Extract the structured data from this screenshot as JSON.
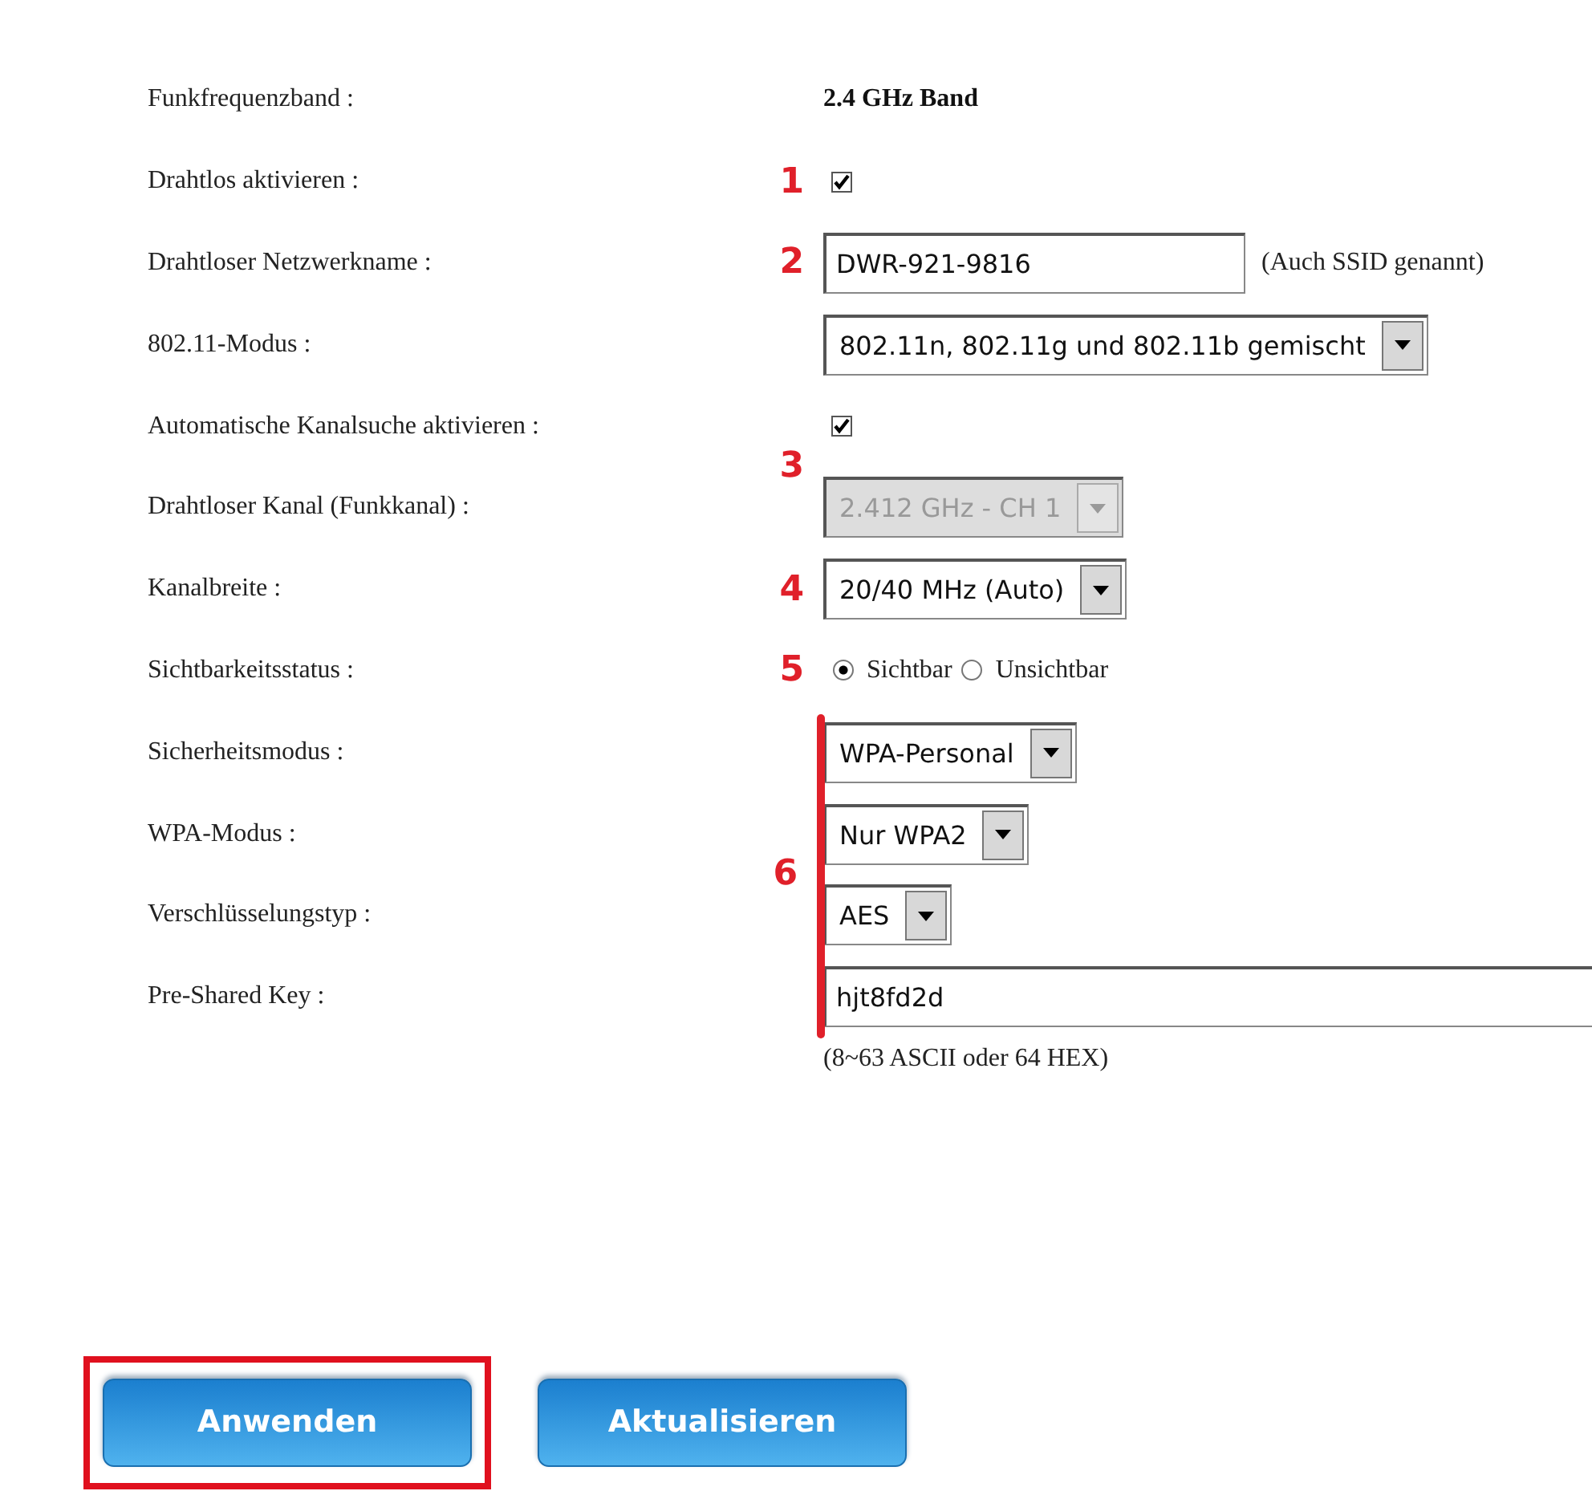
{
  "groups": [
    {
      "fields": [
        {
          "kind": "text",
          "label": "Funkfrequenzband :",
          "value": "2.4 GHz Band"
        }
      ]
    },
    {
      "marker": "1",
      "fields": [
        {
          "kind": "checkbox",
          "label": "Drahtlos aktivieren :",
          "checked": true
        }
      ]
    },
    {
      "marker": "2",
      "fields": [
        {
          "kind": "input",
          "label": "Drahtloser Netzwerkname :",
          "value": "DWR-921-9816",
          "note": "(Auch SSID genannt)"
        }
      ]
    },
    {
      "fields": [
        {
          "kind": "select",
          "label": "802.11-Modus :",
          "value": "802.11n, 802.11g und 802.11b gemischt",
          "disabled": false
        }
      ]
    },
    {
      "marker": "3",
      "fields": [
        {
          "kind": "checkbox",
          "label": "Automatische Kanalsuche aktivieren :",
          "checked": true
        },
        {
          "kind": "select",
          "label": "Drahtloser Kanal (Funkkanal) :",
          "value": "2.412 GHz - CH 1",
          "disabled": true
        }
      ]
    },
    {
      "marker": "4",
      "fields": [
        {
          "kind": "select",
          "label": "Kanalbreite :",
          "value": "20/40 MHz (Auto)",
          "disabled": false
        }
      ]
    },
    {
      "marker": "5",
      "fields": [
        {
          "kind": "radio",
          "label": "Sichtbarkeitsstatus :",
          "options": [
            {
              "label": "Sichtbar",
              "selected": true
            },
            {
              "label": "Unsichtbar",
              "selected": false
            }
          ]
        }
      ]
    },
    {
      "marker": "6",
      "bracket": true,
      "fields": [
        {
          "kind": "select",
          "label": "Sicherheitsmodus :",
          "value": "WPA-Personal",
          "disabled": false
        },
        {
          "kind": "select",
          "label": "WPA-Modus :",
          "value": "Nur WPA2",
          "disabled": false
        },
        {
          "kind": "select",
          "label": "Verschlüsselungstyp :",
          "value": "AES",
          "disabled": false
        },
        {
          "kind": "input",
          "label": "Pre-Shared Key :",
          "value": "hjt8fd2d"
        }
      ],
      "hint": "(8~63 ASCII oder 64 HEX)"
    }
  ],
  "buttons": [
    {
      "label": "Anwenden",
      "highlighted": true
    },
    {
      "label": "Aktualisieren",
      "highlighted": false
    }
  ]
}
